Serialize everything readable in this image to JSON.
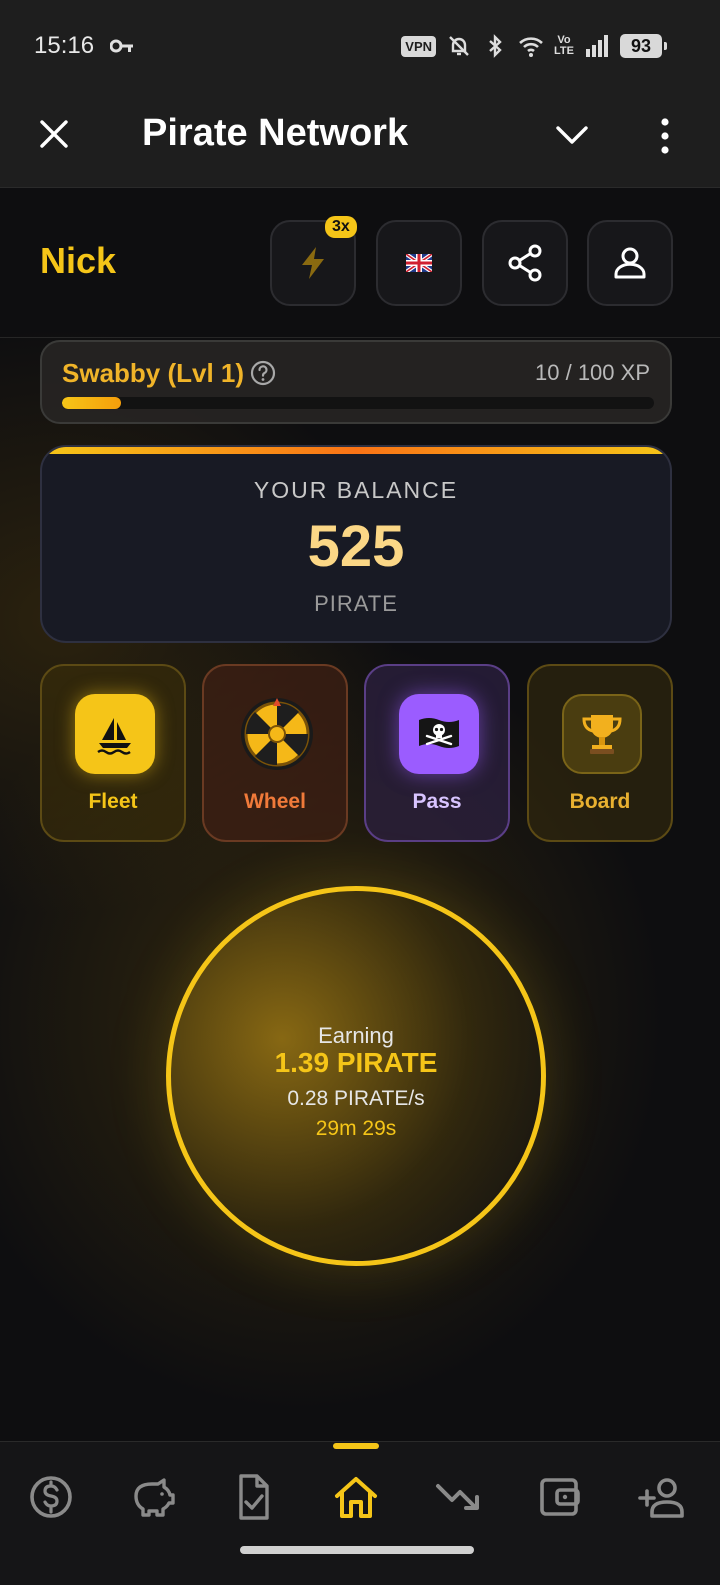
{
  "status_bar": {
    "time": "15:16",
    "vpn_label": "VPN",
    "volte_label_top": "Vo",
    "volte_label_bottom": "LTE",
    "battery": "93",
    "icons": [
      "key-icon",
      "mute-icon",
      "bluetooth-icon",
      "wifi-icon",
      "signal-icon",
      "battery-icon"
    ]
  },
  "header": {
    "title": "Pirate Network",
    "icons": [
      "close-icon",
      "chevron-down-icon",
      "more-vertical-icon"
    ]
  },
  "top_row": {
    "user_name": "Nick",
    "boost_badge": "3x",
    "buttons": [
      "lightning-icon",
      "uk-flag-icon",
      "share-icon",
      "profile-icon"
    ]
  },
  "level": {
    "name": "Swabby (Lvl 1)",
    "xp_text": "10 / 100 XP",
    "xp_progress": 0.1
  },
  "balance": {
    "label": "YOUR BALANCE",
    "value": "525",
    "unit": "PIRATE"
  },
  "features": [
    {
      "label": "Fleet",
      "icon": "sailboat-icon"
    },
    {
      "label": "Wheel",
      "icon": "wheel-icon"
    },
    {
      "label": "Pass",
      "icon": "pirate-flag-icon"
    },
    {
      "label": "Board",
      "icon": "trophy-icon"
    }
  ],
  "earning": {
    "label": "Earning",
    "amount": "1.39 PIRATE",
    "rate": "0.28 PIRATE/s",
    "timer": "29m 29s"
  },
  "bottom_nav": {
    "items": [
      "dollar-icon",
      "piggy-bank-icon",
      "tasks-icon",
      "home-icon",
      "trending-down-icon",
      "wallet-icon",
      "add-user-icon"
    ],
    "active": "home-icon"
  },
  "colors": {
    "accent": "#f5c518",
    "background": "#0e0e10",
    "pass_purple": "#9b5cff",
    "wheel_orange": "#f07a3a"
  }
}
